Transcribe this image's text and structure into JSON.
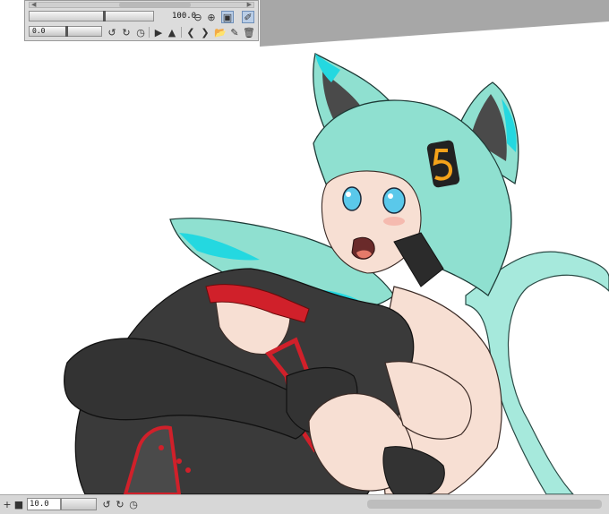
{
  "palette": {
    "zoom_value": "100.0",
    "rotate_value": "0.0",
    "icons": {
      "zoom_out": "zoom-out-icon",
      "zoom_in": "zoom-in-icon",
      "fit": "fit-window-icon",
      "eyedropper": "eyedropper-icon",
      "rotate_left": "rotate-left-icon",
      "rotate_right": "rotate-right-icon",
      "reset_rotation": "reset-rotation-icon",
      "flip_horizontal": "flip-horizontal-icon",
      "flip_vertical": "flip-vertical-icon",
      "prev": "chevron-left-icon",
      "next": "chevron-right-icon",
      "open": "folder-open-icon",
      "new": "new-file-icon",
      "delete": "trash-icon"
    }
  },
  "bottom_bar": {
    "value": "10.0",
    "icons": {
      "add": "plus-icon",
      "stop": "square-icon",
      "rotate_left": "rotate-left-icon",
      "rotate_right": "rotate-right-icon",
      "reset": "reset-rotation-icon"
    }
  },
  "colors": {
    "hair": "#8fe0d0",
    "hair_accent": "#24d8e0",
    "suit": "#3a3a3a",
    "trim": "#d0202a",
    "skin": "#f7dfd3",
    "ui_gray": "#a7a7a7"
  }
}
